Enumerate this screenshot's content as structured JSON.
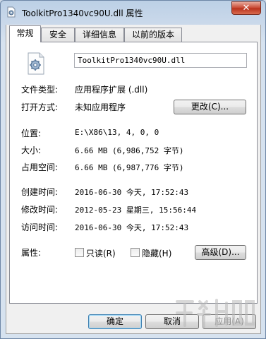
{
  "window": {
    "title": "ToolkitPro1340vc90U.dll 属性"
  },
  "tabs": [
    {
      "label": "常规"
    },
    {
      "label": "安全"
    },
    {
      "label": "详细信息"
    },
    {
      "label": "以前的版本"
    }
  ],
  "general": {
    "filename": "ToolkitPro1340vc90U.dll",
    "file_type_label": "文件类型:",
    "file_type_value": "应用程序扩展 (.dll)",
    "open_with_label": "打开方式:",
    "open_with_value": "未知应用程序",
    "change_button": "更改(C)...",
    "location_label": "位置:",
    "location_value": "E:\\X86\\13, 4, 0, 0",
    "size_label": "大小:",
    "size_value": "6.66 MB (6,986,752 字节)",
    "size_on_disk_label": "占用空间:",
    "size_on_disk_value": "6.66 MB (6,987,776 字节)",
    "created_label": "创建时间:",
    "created_value": "2016-06-30 今天, 17:52:43",
    "modified_label": "修改时间:",
    "modified_value": "2012-05-23 星期三, 15:56:44",
    "accessed_label": "访问时间:",
    "accessed_value": "2016-06-30 今天, 17:52:43",
    "attributes_label": "属性:",
    "readonly_label": "只读(R)",
    "hidden_label": "隐藏(H)",
    "advanced_button": "高级(D)..."
  },
  "footer": {
    "ok": "确定",
    "cancel": "取消",
    "apply": "应用(A)"
  },
  "icons": {
    "app": "dll-file-icon",
    "file": "dll-gear-file-icon",
    "close": "close-icon"
  },
  "colors": {
    "titlebar": "#c9d8ea",
    "close": "#c7452f",
    "panel": "#ffffff",
    "client": "#f0f0f0"
  }
}
